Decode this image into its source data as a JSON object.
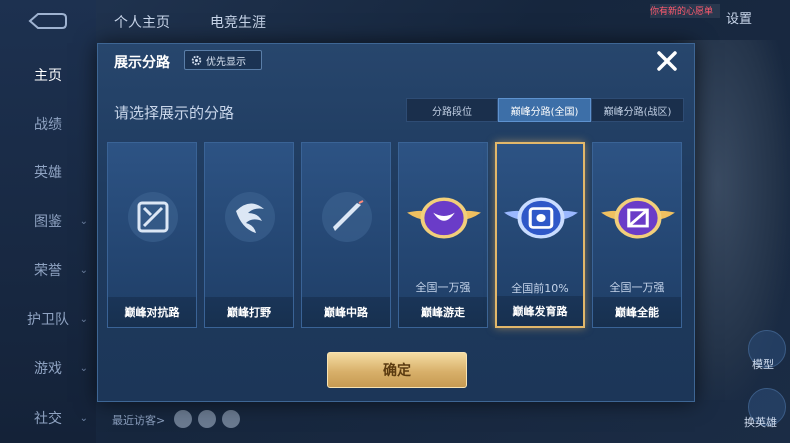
{
  "background": {
    "sidebar": [
      {
        "label": "主页",
        "active": true
      },
      {
        "label": "战绩",
        "active": false
      },
      {
        "label": "英雄",
        "active": false
      },
      {
        "label": "图鉴",
        "active": false
      },
      {
        "label": "荣誉",
        "active": false
      },
      {
        "label": "护卫队",
        "active": false
      },
      {
        "label": "游戏",
        "active": false
      },
      {
        "label": "社交",
        "active": false
      }
    ],
    "top_tabs": [
      "个人主页",
      "电竞生涯"
    ],
    "settings_label": "设置",
    "promo_text": "你有新的心愿单",
    "recent_label": "最近访客>",
    "right_buttons": [
      "模型",
      "换英雄"
    ]
  },
  "modal": {
    "title": "展示分路",
    "priority_button": "优先显示",
    "subtitle": "请选择展示的分路",
    "segments": [
      {
        "label": "分路段位",
        "active": false
      },
      {
        "label": "巅峰分路(全国)",
        "active": true
      },
      {
        "label": "巅峰分路(战区)",
        "active": false
      }
    ],
    "cards": [
      {
        "label": "巅峰对抗路",
        "rank": "",
        "icon": "clash-lane-icon",
        "badge": false
      },
      {
        "label": "巅峰打野",
        "rank": "",
        "icon": "jungle-icon",
        "badge": false
      },
      {
        "label": "巅峰中路",
        "rank": "",
        "icon": "mid-lane-icon",
        "badge": false
      },
      {
        "label": "巅峰游走",
        "rank": "全国一万强",
        "icon": "roam-badge-icon",
        "badge": true
      },
      {
        "label": "巅峰发育路",
        "rank": "全国前10%",
        "icon": "farm-lane-badge-icon",
        "badge": true,
        "selected": true
      },
      {
        "label": "巅峰全能",
        "rank": "全国一万强",
        "icon": "all-round-badge-icon",
        "badge": true
      }
    ],
    "confirm_label": "确定"
  },
  "colors": {
    "accent_gold": "#e2b76a",
    "active_segment": "#3d6fa8",
    "badge_purple": "#6a3cc8"
  }
}
